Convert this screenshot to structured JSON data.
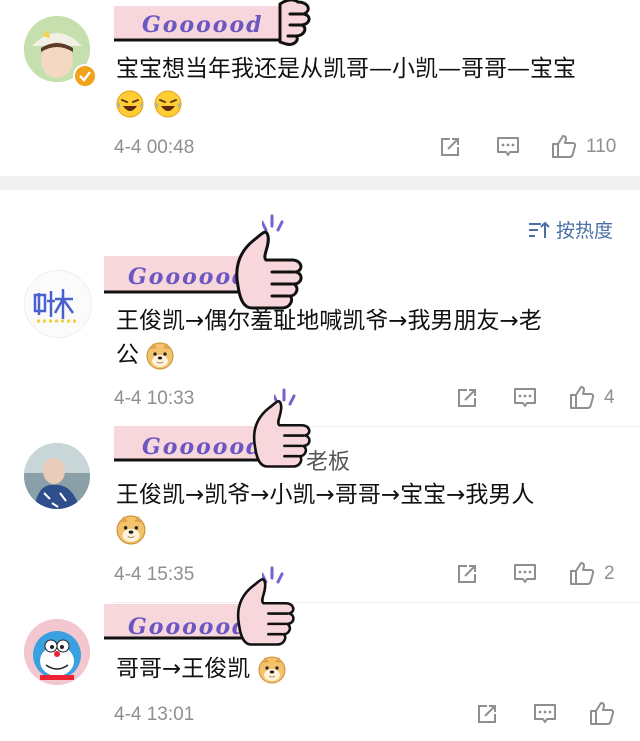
{
  "sticker_text": "Goooood",
  "sort_label": "按热度",
  "comments": [
    {
      "text_line1": "宝宝想当年我还是从凯哥—小凯—哥哥—宝宝",
      "text_line2": "",
      "emoji": "rofl-emoji x2",
      "time": "4-4 00:48",
      "likes": "110"
    },
    {
      "text_line1": "王俊凯→偶尔羞耻地喊凯爷→我男朋友→老",
      "text_line2": "公",
      "time": "4-4 10:33",
      "likes": "4"
    },
    {
      "name_tail": "老板",
      "text_line1": "王俊凯→凯爷→小凯→哥哥→宝宝→我男人",
      "text_line2": "",
      "time": "4-4 15:35",
      "likes": "2"
    },
    {
      "text_line1": "哥哥→王俊凯",
      "time": "4-4 13:01",
      "likes": ""
    }
  ],
  "colors": {
    "sticker_fill": "#f7d6dc",
    "sticker_text": "#6b57c2",
    "timestamp": "#8f8f8f",
    "sort_link": "#4a6fa5"
  }
}
